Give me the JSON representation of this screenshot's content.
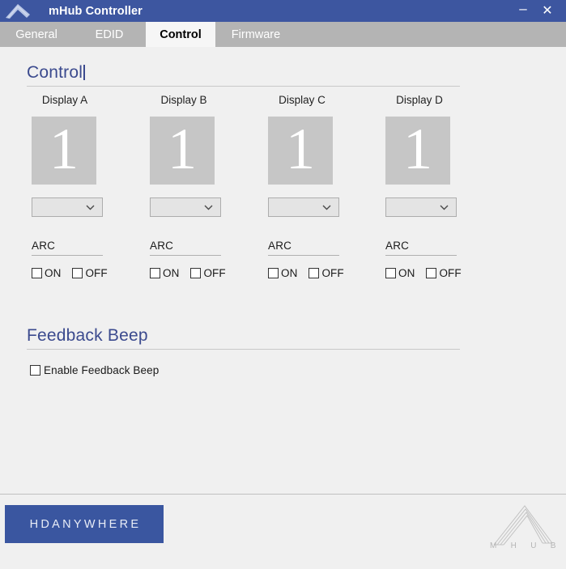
{
  "window": {
    "title": "mHub Controller",
    "icon": "mhub-peak-icon",
    "minimize_label": "–",
    "close_label": "✕",
    "accent_color": "#3d56a0"
  },
  "tabs": [
    {
      "label": "General",
      "active": false
    },
    {
      "label": "EDID",
      "active": false
    },
    {
      "label": "Control",
      "active": true
    },
    {
      "label": "Firmware",
      "active": false
    }
  ],
  "control_section": {
    "heading": "Control",
    "heading_color": "#3b4a8e",
    "displays": [
      {
        "label": "Display A",
        "source_number": "1",
        "select_value": "",
        "arc_label": "ARC",
        "on_label": "ON",
        "on_checked": false,
        "off_label": "OFF",
        "off_checked": false
      },
      {
        "label": "Display B",
        "source_number": "1",
        "select_value": "",
        "arc_label": "ARC",
        "on_label": "ON",
        "on_checked": false,
        "off_label": "OFF",
        "off_checked": false
      },
      {
        "label": "Display C",
        "source_number": "1",
        "select_value": "",
        "arc_label": "ARC",
        "on_label": "ON",
        "on_checked": false,
        "off_label": "OFF",
        "off_checked": false
      },
      {
        "label": "Display D",
        "source_number": "1",
        "select_value": "",
        "arc_label": "ARC",
        "on_label": "ON",
        "on_checked": false,
        "off_label": "OFF",
        "off_checked": false
      }
    ]
  },
  "feedback_section": {
    "heading": "Feedback Beep",
    "checkbox_label": "Enable Feedback Beep",
    "checked": false
  },
  "footer": {
    "brand": "HDANYWHERE",
    "brand_color": "#3a56a0",
    "product_letters": [
      "M",
      "H",
      "U",
      "B"
    ],
    "product_logo_icon": "mhub-peak-icon"
  }
}
